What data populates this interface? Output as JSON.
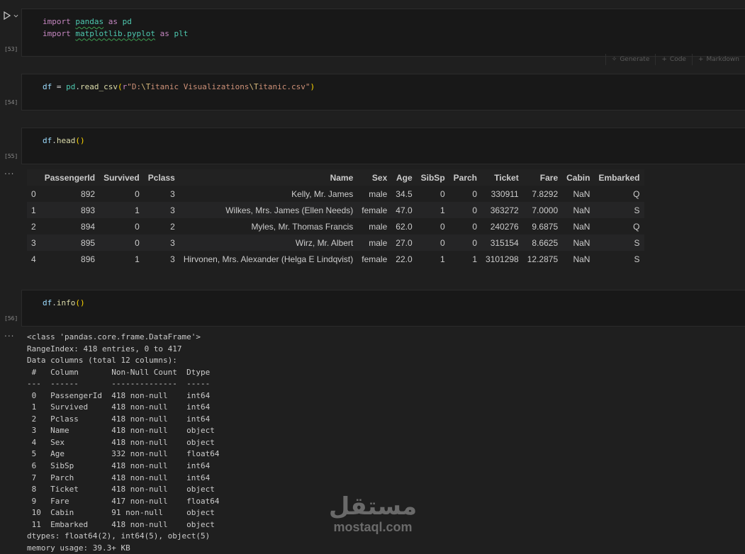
{
  "cells": [
    {
      "exec": "[53]",
      "lines": [
        [
          {
            "t": "import",
            "c": "kw"
          },
          {
            "t": " "
          },
          {
            "t": "pandas",
            "c": "mod squig"
          },
          {
            "t": " "
          },
          {
            "t": "as",
            "c": "kw"
          },
          {
            "t": " "
          },
          {
            "t": "pd",
            "c": "mod"
          }
        ],
        [
          {
            "t": "import",
            "c": "kw"
          },
          {
            "t": " "
          },
          {
            "t": "matplotlib.pyplot",
            "c": "mod squig"
          },
          {
            "t": " "
          },
          {
            "t": "as",
            "c": "kw"
          },
          {
            "t": " "
          },
          {
            "t": "plt",
            "c": "mod"
          }
        ]
      ]
    },
    {
      "exec": "[54]",
      "lines": [
        [
          {
            "t": "df",
            "c": "var"
          },
          {
            "t": " = ",
            "c": "op"
          },
          {
            "t": "pd",
            "c": "mod"
          },
          {
            "t": ".",
            "c": "plain"
          },
          {
            "t": "read_csv",
            "c": "fn"
          },
          {
            "t": "(",
            "c": "paren"
          },
          {
            "t": "r",
            "c": "kw"
          },
          {
            "t": "\"D:",
            "c": "str"
          },
          {
            "t": "\\T",
            "c": "esc"
          },
          {
            "t": "itanic Visualizations",
            "c": "str"
          },
          {
            "t": "\\T",
            "c": "esc"
          },
          {
            "t": "itanic.csv\"",
            "c": "str"
          },
          {
            "t": ")",
            "c": "paren"
          }
        ]
      ]
    },
    {
      "exec": "[55]",
      "lines": [
        [
          {
            "t": "df",
            "c": "var"
          },
          {
            "t": ".",
            "c": "plain"
          },
          {
            "t": "head",
            "c": "fn"
          },
          {
            "t": "()",
            "c": "paren"
          }
        ]
      ]
    },
    {
      "exec": "[56]",
      "lines": [
        [
          {
            "t": "df",
            "c": "var"
          },
          {
            "t": ".",
            "c": "plain"
          },
          {
            "t": "info",
            "c": "fn"
          },
          {
            "t": "()",
            "c": "paren"
          }
        ]
      ]
    }
  ],
  "toolbar": {
    "generate": "Generate",
    "code": "Code",
    "markdown": "Markdown"
  },
  "table": {
    "columns": [
      "",
      "PassengerId",
      "Survived",
      "Pclass",
      "Name",
      "Sex",
      "Age",
      "SibSp",
      "Parch",
      "Ticket",
      "Fare",
      "Cabin",
      "Embarked"
    ],
    "rows": [
      [
        "0",
        "892",
        "0",
        "3",
        "Kelly, Mr. James",
        "male",
        "34.5",
        "0",
        "0",
        "330911",
        "7.8292",
        "NaN",
        "Q"
      ],
      [
        "1",
        "893",
        "1",
        "3",
        "Wilkes, Mrs. James (Ellen Needs)",
        "female",
        "47.0",
        "1",
        "0",
        "363272",
        "7.0000",
        "NaN",
        "S"
      ],
      [
        "2",
        "894",
        "0",
        "2",
        "Myles, Mr. Thomas Francis",
        "male",
        "62.0",
        "0",
        "0",
        "240276",
        "9.6875",
        "NaN",
        "Q"
      ],
      [
        "3",
        "895",
        "0",
        "3",
        "Wirz, Mr. Albert",
        "male",
        "27.0",
        "0",
        "0",
        "315154",
        "8.6625",
        "NaN",
        "S"
      ],
      [
        "4",
        "896",
        "1",
        "3",
        "Hirvonen, Mrs. Alexander (Helga E Lindqvist)",
        "female",
        "22.0",
        "1",
        "1",
        "3101298",
        "12.2875",
        "NaN",
        "S"
      ]
    ]
  },
  "info_output": "<class 'pandas.core.frame.DataFrame'>\nRangeIndex: 418 entries, 0 to 417\nData columns (total 12 columns):\n #   Column       Non-Null Count  Dtype  \n---  ------       --------------  -----  \n 0   PassengerId  418 non-null    int64  \n 1   Survived     418 non-null    int64  \n 2   Pclass       418 non-null    int64  \n 3   Name         418 non-null    object \n 4   Sex          418 non-null    object \n 5   Age          332 non-null    float64\n 6   SibSp        418 non-null    int64  \n 7   Parch        418 non-null    int64  \n 8   Ticket       418 non-null    object \n 9   Fare         417 non-null    float64\n 10  Cabin        91 non-null     object \n 11  Embarked     418 non-null    object \ndtypes: float64(2), int64(5), object(5)\nmemory usage: 39.3+ KB",
  "output_ellipsis": "...",
  "watermark": {
    "arabic": "مستقل",
    "latin": "mostaql.com"
  }
}
